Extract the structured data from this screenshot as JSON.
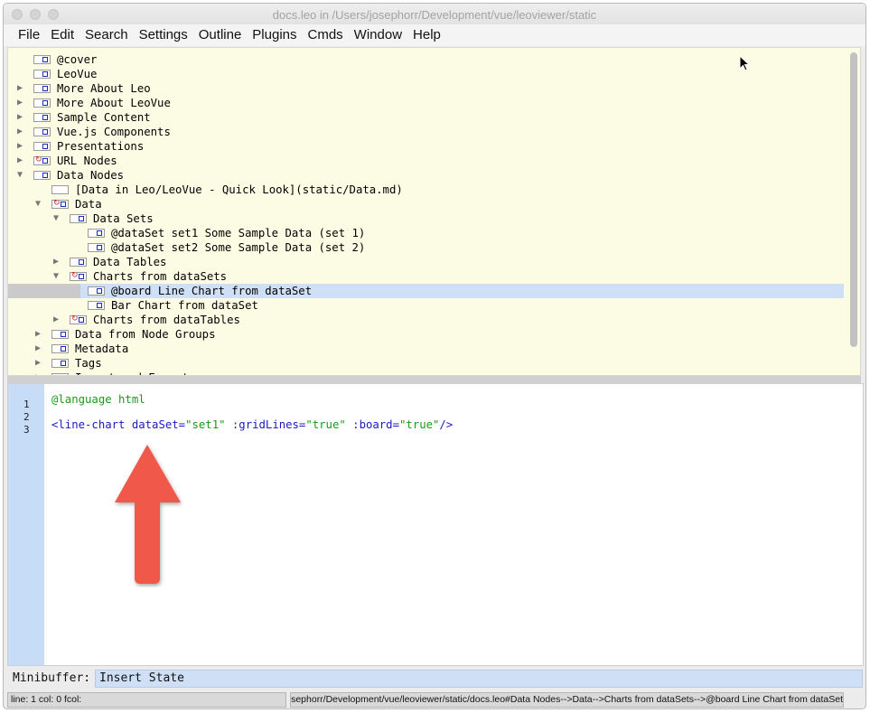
{
  "window": {
    "title": "docs.leo in /Users/josephorr/Development/vue/leoviewer/static"
  },
  "menu": [
    "File",
    "Edit",
    "Search",
    "Settings",
    "Outline",
    "Plugins",
    "Cmds",
    "Window",
    "Help"
  ],
  "outline": {
    "nodes": [
      {
        "label": "@cover",
        "expander": "",
        "clone": false
      },
      {
        "label": "LeoVue",
        "expander": "",
        "clone": false
      },
      {
        "label": "More About Leo",
        "expander": "collapsed",
        "clone": false
      },
      {
        "label": "More About LeoVue",
        "expander": "collapsed",
        "clone": false
      },
      {
        "label": "Sample Content",
        "expander": "collapsed",
        "clone": false
      },
      {
        "label": "Vue.js Components",
        "expander": "collapsed",
        "clone": false
      },
      {
        "label": "Presentations",
        "expander": "collapsed",
        "clone": false
      },
      {
        "label": "URL Nodes",
        "expander": "collapsed",
        "clone": true
      },
      {
        "label": "Data Nodes",
        "expander": "expanded",
        "clone": false
      },
      {
        "label": "[Data in Leo/LeoVue - Quick Look](static/Data.md)",
        "expander": "",
        "clone": false,
        "empty": true
      },
      {
        "label": "Data",
        "expander": "expanded",
        "clone": true
      },
      {
        "label": "Data Sets",
        "expander": "expanded",
        "clone": false
      },
      {
        "label": "@dataSet set1 Some Sample Data (set 1)",
        "expander": "",
        "clone": false
      },
      {
        "label": "@dataSet set2 Some Sample Data (set 2)",
        "expander": "",
        "clone": false
      },
      {
        "label": "Data Tables",
        "expander": "collapsed",
        "clone": false
      },
      {
        "label": "Charts from dataSets",
        "expander": "expanded",
        "clone": true
      },
      {
        "label": "@board Line Chart from dataSet",
        "expander": "",
        "clone": false,
        "selected": true
      },
      {
        "label": "Bar Chart from dataSet",
        "expander": "",
        "clone": false
      },
      {
        "label": "Charts from dataTables",
        "expander": "collapsed",
        "clone": true
      },
      {
        "label": "Data from Node Groups",
        "expander": "collapsed",
        "clone": false
      },
      {
        "label": "Metadata",
        "expander": "collapsed",
        "clone": false
      },
      {
        "label": "Tags",
        "expander": "collapsed",
        "clone": false
      },
      {
        "label": "Import and Export",
        "expander": "collapsed",
        "clone": false
      }
    ]
  },
  "body": {
    "line_numbers": [
      "1",
      "2",
      "3"
    ],
    "line1": "@language html",
    "line3": {
      "tag_open": "<line-chart ",
      "attr1": "dataSet=",
      "val1": "\"set1\"",
      "attr2": " :gridLines=",
      "val2": "\"true\"",
      "attr3": " :board=",
      "val3": "\"true\"",
      "tag_close": "/>"
    }
  },
  "minibuffer": {
    "label": "Minibuffer:",
    "value": "Insert State"
  },
  "status": {
    "position": "line: 1 col: 0 fcol:",
    "path": "ers/josephorr/Development/vue/leoviewer/static/docs.leo#Data Nodes-->Data-->Charts from dataSets-->@board Line Chart from dataSet"
  },
  "colors": {
    "outline_bg": "#fcfce4",
    "selection": "#cfe0f6",
    "gutter": "#c7dcf7",
    "arrow": "#f0584a",
    "clone_mark": "#d21c1c"
  }
}
